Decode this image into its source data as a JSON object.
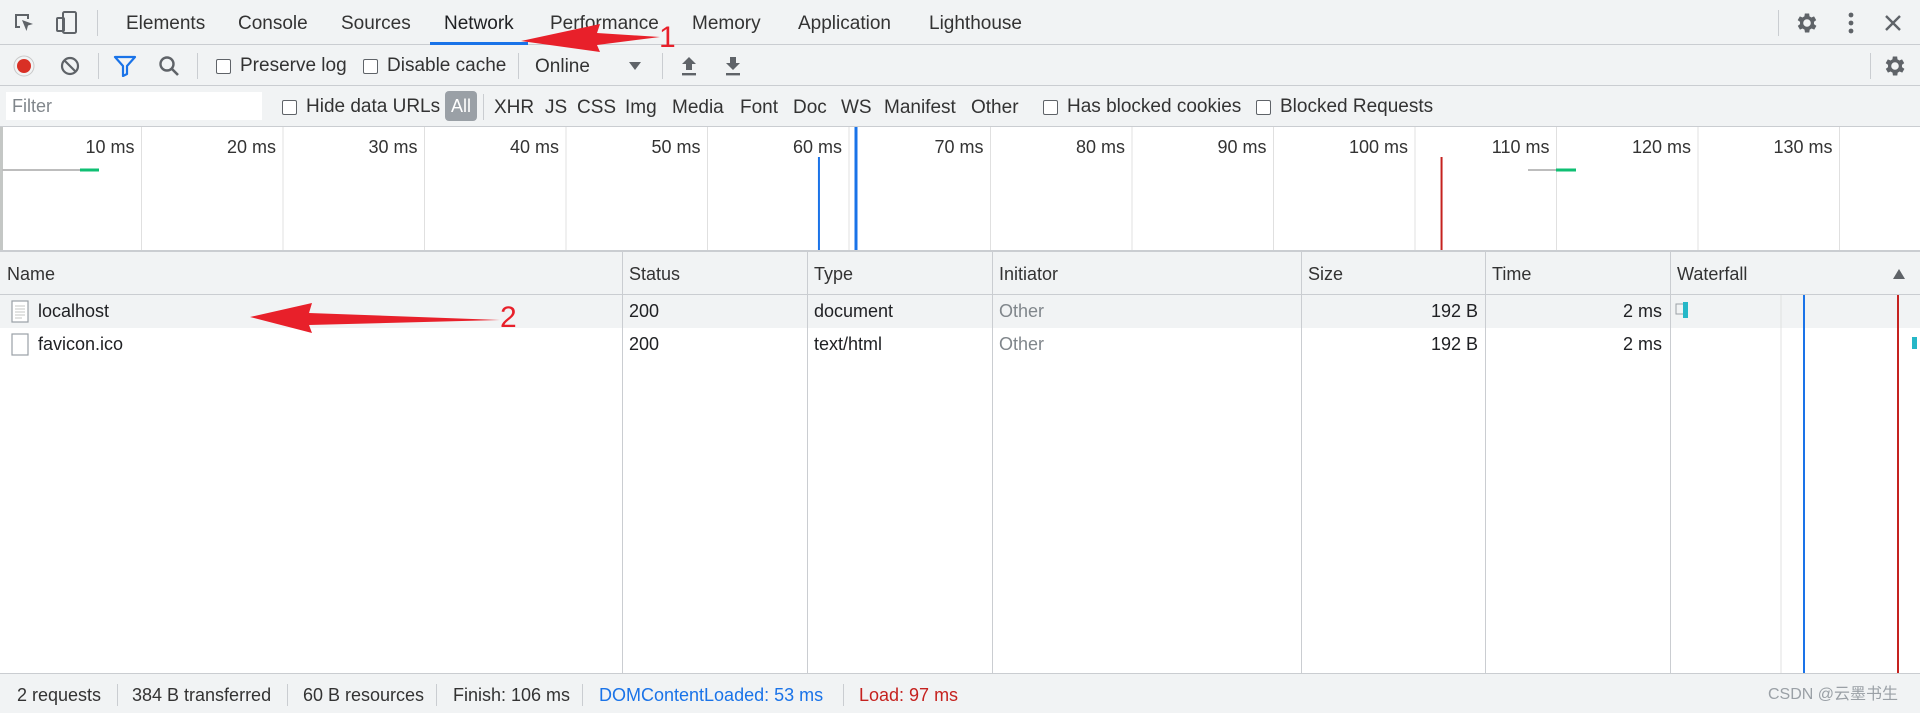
{
  "tabs": [
    "Elements",
    "Console",
    "Sources",
    "Network",
    "Performance",
    "Memory",
    "Application",
    "Lighthouse"
  ],
  "active_tab": "Network",
  "toolbar": {
    "preserve_log": "Preserve log",
    "disable_cache": "Disable cache",
    "throttle": "Online"
  },
  "filter": {
    "placeholder": "Filter",
    "hide_data_urls": "Hide data URLs",
    "types": [
      "All",
      "XHR",
      "JS",
      "CSS",
      "Img",
      "Media",
      "Font",
      "Doc",
      "WS",
      "Manifest",
      "Other"
    ],
    "active_type": "All",
    "has_blocked_cookies": "Has blocked cookies",
    "blocked_requests": "Blocked Requests"
  },
  "overview": {
    "ticks": [
      "10 ms",
      "20 ms",
      "30 ms",
      "40 ms",
      "50 ms",
      "60 ms",
      "70 ms",
      "80 ms",
      "90 ms",
      "100 ms",
      "110 ms",
      "120 ms",
      "130 ms"
    ],
    "dom_content_loaded_ms": 53,
    "load_ms": 97
  },
  "columns": [
    "Name",
    "Status",
    "Type",
    "Initiator",
    "Size",
    "Time",
    "Waterfall"
  ],
  "rows": [
    {
      "name": "localhost",
      "status": "200",
      "type": "document",
      "initiator": "Other",
      "size": "192 B",
      "time": "2 ms"
    },
    {
      "name": "favicon.ico",
      "status": "200",
      "type": "text/html",
      "initiator": "Other",
      "size": "192 B",
      "time": "2 ms"
    }
  ],
  "status": {
    "requests": "2 requests",
    "transferred": "384 B transferred",
    "resources": "60 B resources",
    "finish": "Finish: 106 ms",
    "dcl": "DOMContentLoaded: 53 ms",
    "load": "Load: 97 ms",
    "watermark": "CSDN @云墨书生"
  },
  "annotations": {
    "label1": "1",
    "label2": "2"
  },
  "colors": {
    "accent": "#1a73e8",
    "record": "#d93025",
    "dcl": "#1a73e8",
    "load": "#c5221f",
    "bar": "#26b7c7"
  }
}
